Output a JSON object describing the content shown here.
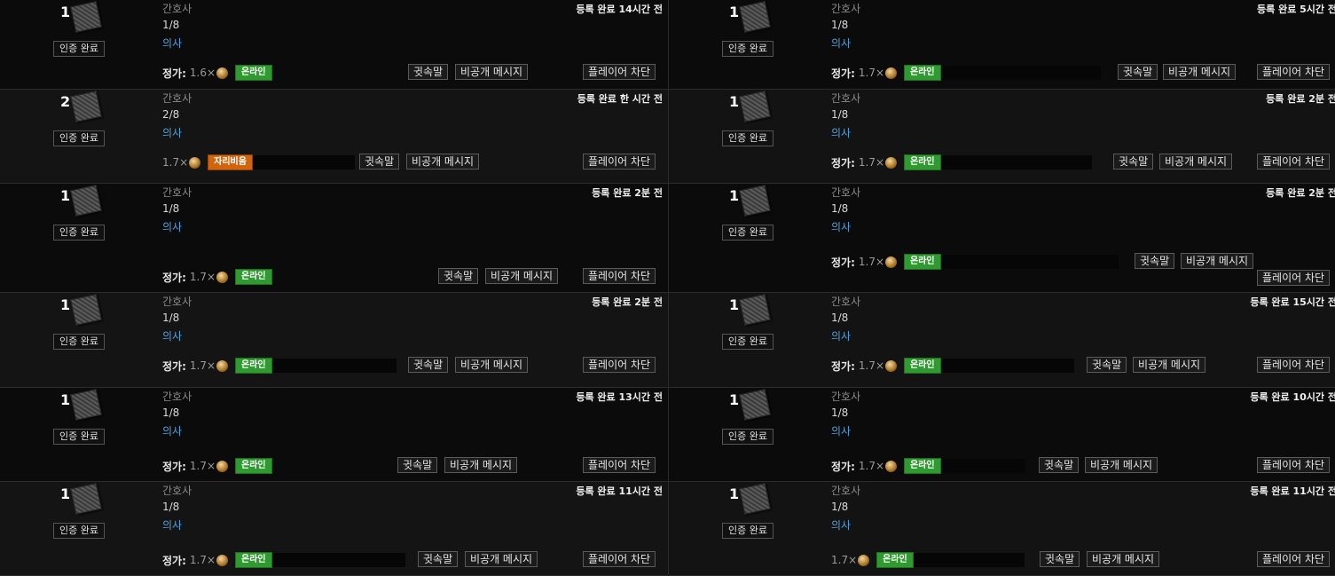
{
  "labels": {
    "certified": "인증 완료",
    "nurse": "간호사",
    "doctor": "의사",
    "price_label": "정가:",
    "whisper": "귓속말",
    "private_message": "비공개 메시지",
    "block_player": "플레이어 차단"
  },
  "colors": {
    "online": "#2f9a2f",
    "afk": "#d0650e",
    "doctor_link": "#4aa3e0"
  },
  "left": [
    {
      "qty": "1",
      "fraction": "1/8",
      "registered": "등록 완료 14시간 전",
      "price": "1.6×",
      "show_price_label": true,
      "status": "온라인"
    },
    {
      "qty": "2",
      "fraction": "2/8",
      "registered": "등록 완료 한 시간 전",
      "price": "1.7×",
      "show_price_label": false,
      "status": "자리비움"
    },
    {
      "qty": "1",
      "fraction": "1/8",
      "registered": "등록 완료 2분 전",
      "price": "1.7×",
      "show_price_label": true,
      "status": "온라인"
    },
    {
      "qty": "1",
      "fraction": "1/8",
      "registered": "등록 완료 2분 전",
      "price": "1.7×",
      "show_price_label": true,
      "status": "온라인"
    },
    {
      "qty": "1",
      "fraction": "1/8",
      "registered": "등록 완료 13시간 전",
      "price": "1.7×",
      "show_price_label": true,
      "status": "온라인"
    },
    {
      "qty": "1",
      "fraction": "1/8",
      "registered": "등록 완료 11시간 전",
      "price": "1.7×",
      "show_price_label": true,
      "status": "온라인"
    }
  ],
  "right": [
    {
      "qty": "1",
      "fraction": "1/8",
      "registered": "등록 완료 5시간 전",
      "price": "1.7×",
      "show_price_label": true,
      "status": "온라인"
    },
    {
      "qty": "1",
      "fraction": "1/8",
      "registered": "등록 완료 2분 전",
      "price": "1.7×",
      "show_price_label": true,
      "status": "온라인"
    },
    {
      "qty": "1",
      "fraction": "1/8",
      "registered": "등록 완료 2분 전",
      "price": "1.7×",
      "show_price_label": true,
      "status": "온라인"
    },
    {
      "qty": "1",
      "fraction": "1/8",
      "registered": "등록 완료 15시간 전",
      "price": "1.7×",
      "show_price_label": true,
      "status": "온라인"
    },
    {
      "qty": "1",
      "fraction": "1/8",
      "registered": "등록 완료 10시간 전",
      "price": "1.7×",
      "show_price_label": true,
      "status": "온라인"
    },
    {
      "qty": "1",
      "fraction": "1/8",
      "registered": "등록 완료 11시간 전",
      "price": "1.7×",
      "show_price_label": false,
      "status": "온라인"
    }
  ]
}
